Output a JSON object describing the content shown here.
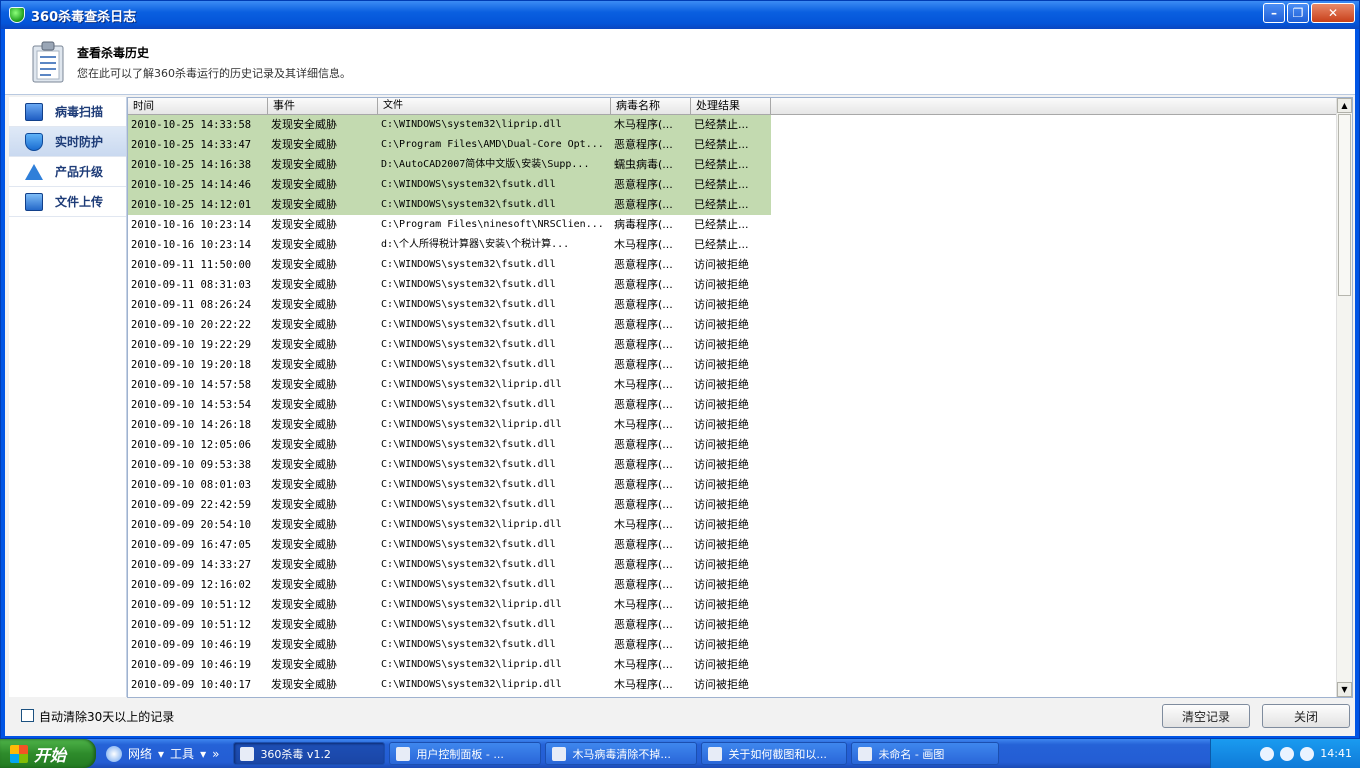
{
  "window": {
    "title": "360杀毒查杀日志",
    "buttons": {
      "minimize": "–",
      "maximize": "❐",
      "close": "✕"
    }
  },
  "header": {
    "title": "查看杀毒历史",
    "subtitle": "您在此可以了解360杀毒运行的历史记录及其详细信息。",
    "icon": "clipboard-icon"
  },
  "sidebar": {
    "items": [
      {
        "label": "病毒扫描",
        "icon": "monitor-icon"
      },
      {
        "label": "实时防护",
        "icon": "shield-icon",
        "active": true
      },
      {
        "label": "产品升级",
        "icon": "upgrade-arrow-icon"
      },
      {
        "label": "文件上传",
        "icon": "file-upload-icon"
      }
    ]
  },
  "table": {
    "columns": [
      "时间",
      "事件",
      "文件",
      "病毒名称",
      "处理结果"
    ],
    "highlight_color": "#c3dab0",
    "rows": [
      [
        "2010-10-25 14:33:58",
        "发现安全威胁",
        "C:\\WINDOWS\\system32\\liprip.dll",
        "木马程序(...",
        "已经禁止..."
      ],
      [
        "2010-10-25 14:33:47",
        "发现安全威胁",
        "C:\\Program Files\\AMD\\Dual-Core Opt...",
        "恶意程序(...",
        "已经禁止..."
      ],
      [
        "2010-10-25 14:16:38",
        "发现安全威胁",
        "D:\\AutoCAD2007简体中文版\\安装\\Supp...",
        "蠕虫病毒(...",
        "已经禁止..."
      ],
      [
        "2010-10-25 14:14:46",
        "发现安全威胁",
        "C:\\WINDOWS\\system32\\fsutk.dll",
        "恶意程序(...",
        "已经禁止..."
      ],
      [
        "2010-10-25 14:12:01",
        "发现安全威胁",
        "C:\\WINDOWS\\system32\\fsutk.dll",
        "恶意程序(...",
        "已经禁止..."
      ],
      [
        "2010-10-16 10:23:14",
        "发现安全威胁",
        "C:\\Program Files\\ninesoft\\NRSClien...",
        "病毒程序(...",
        "已经禁止..."
      ],
      [
        "2010-10-16 10:23:14",
        "发现安全威胁",
        "d:\\个人所得税计算器\\安装\\个税计算...",
        "木马程序(...",
        "已经禁止..."
      ],
      [
        "2010-09-11 11:50:00",
        "发现安全威胁",
        "C:\\WINDOWS\\system32\\fsutk.dll",
        "恶意程序(...",
        "访问被拒绝"
      ],
      [
        "2010-09-11 08:31:03",
        "发现安全威胁",
        "C:\\WINDOWS\\system32\\fsutk.dll",
        "恶意程序(...",
        "访问被拒绝"
      ],
      [
        "2010-09-11 08:26:24",
        "发现安全威胁",
        "C:\\WINDOWS\\system32\\fsutk.dll",
        "恶意程序(...",
        "访问被拒绝"
      ],
      [
        "2010-09-10 20:22:22",
        "发现安全威胁",
        "C:\\WINDOWS\\system32\\fsutk.dll",
        "恶意程序(...",
        "访问被拒绝"
      ],
      [
        "2010-09-10 19:22:29",
        "发现安全威胁",
        "C:\\WINDOWS\\system32\\fsutk.dll",
        "恶意程序(...",
        "访问被拒绝"
      ],
      [
        "2010-09-10 19:20:18",
        "发现安全威胁",
        "C:\\WINDOWS\\system32\\fsutk.dll",
        "恶意程序(...",
        "访问被拒绝"
      ],
      [
        "2010-09-10 14:57:58",
        "发现安全威胁",
        "C:\\WINDOWS\\system32\\liprip.dll",
        "木马程序(...",
        "访问被拒绝"
      ],
      [
        "2010-09-10 14:53:54",
        "发现安全威胁",
        "C:\\WINDOWS\\system32\\fsutk.dll",
        "恶意程序(...",
        "访问被拒绝"
      ],
      [
        "2010-09-10 14:26:18",
        "发现安全威胁",
        "C:\\WINDOWS\\system32\\liprip.dll",
        "木马程序(...",
        "访问被拒绝"
      ],
      [
        "2010-09-10 12:05:06",
        "发现安全威胁",
        "C:\\WINDOWS\\system32\\fsutk.dll",
        "恶意程序(...",
        "访问被拒绝"
      ],
      [
        "2010-09-10 09:53:38",
        "发现安全威胁",
        "C:\\WINDOWS\\system32\\fsutk.dll",
        "恶意程序(...",
        "访问被拒绝"
      ],
      [
        "2010-09-10 08:01:03",
        "发现安全威胁",
        "C:\\WINDOWS\\system32\\fsutk.dll",
        "恶意程序(...",
        "访问被拒绝"
      ],
      [
        "2010-09-09 22:42:59",
        "发现安全威胁",
        "C:\\WINDOWS\\system32\\fsutk.dll",
        "恶意程序(...",
        "访问被拒绝"
      ],
      [
        "2010-09-09 20:54:10",
        "发现安全威胁",
        "C:\\WINDOWS\\system32\\liprip.dll",
        "木马程序(...",
        "访问被拒绝"
      ],
      [
        "2010-09-09 16:47:05",
        "发现安全威胁",
        "C:\\WINDOWS\\system32\\fsutk.dll",
        "恶意程序(...",
        "访问被拒绝"
      ],
      [
        "2010-09-09 14:33:27",
        "发现安全威胁",
        "C:\\WINDOWS\\system32\\fsutk.dll",
        "恶意程序(...",
        "访问被拒绝"
      ],
      [
        "2010-09-09 12:16:02",
        "发现安全威胁",
        "C:\\WINDOWS\\system32\\fsutk.dll",
        "恶意程序(...",
        "访问被拒绝"
      ],
      [
        "2010-09-09 10:51:12",
        "发现安全威胁",
        "C:\\WINDOWS\\system32\\liprip.dll",
        "木马程序(...",
        "访问被拒绝"
      ],
      [
        "2010-09-09 10:51:12",
        "发现安全威胁",
        "C:\\WINDOWS\\system32\\fsutk.dll",
        "恶意程序(...",
        "访问被拒绝"
      ],
      [
        "2010-09-09 10:46:19",
        "发现安全威胁",
        "C:\\WINDOWS\\system32\\fsutk.dll",
        "恶意程序(...",
        "访问被拒绝"
      ],
      [
        "2010-09-09 10:46:19",
        "发现安全威胁",
        "C:\\WINDOWS\\system32\\liprip.dll",
        "木马程序(...",
        "访问被拒绝"
      ],
      [
        "2010-09-09 10:40:17",
        "发现安全威胁",
        "C:\\WINDOWS\\system32\\liprip.dll",
        "木马程序(...",
        "访问被拒绝"
      ]
    ],
    "highlighted_rows": 5
  },
  "footer": {
    "auto_clean_label": "自动清除30天以上的记录",
    "auto_clean_checked": false,
    "clear_button": "清空记录",
    "close_button": "关闭"
  },
  "taskbar": {
    "start_label": "开始",
    "quick_launch": [
      "网络",
      "工具"
    ],
    "tasks": [
      {
        "label": "360杀毒 v1.2",
        "active": true
      },
      {
        "label": "用户控制面板 - ..."
      },
      {
        "label": "木马病毒清除不掉..."
      },
      {
        "label": "关于如何截图和以..."
      },
      {
        "label": "未命名 - 画图"
      }
    ],
    "clock": "14:41"
  }
}
